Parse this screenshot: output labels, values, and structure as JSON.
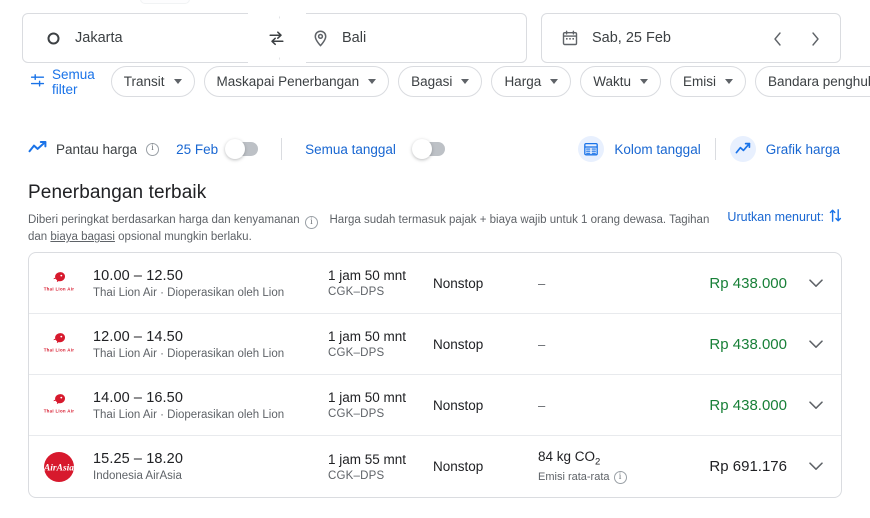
{
  "search": {
    "origin": "Jakarta",
    "destination": "Bali",
    "date": "Sab, 25 Feb",
    "swap_label": "swap-icon",
    "prev_label": "‹",
    "next_label": "›"
  },
  "filters": {
    "all_filters_label": "Semua filter",
    "chips": [
      {
        "label": "Transit"
      },
      {
        "label": "Maskapai Penerbangan"
      },
      {
        "label": "Bagasi"
      },
      {
        "label": "Harga"
      },
      {
        "label": "Waktu"
      },
      {
        "label": "Emisi"
      },
      {
        "label": "Bandara penghubung"
      }
    ]
  },
  "track": {
    "label": "Pantau harga",
    "date": "25 Feb",
    "all_dates": "Semua tanggal",
    "date_grid": "Kolom tanggal",
    "price_graph": "Grafik harga"
  },
  "section": {
    "title": "Penerbangan terbaik",
    "subtitle_a": "Diberi peringkat berdasarkan harga dan kenyamanan",
    "subtitle_b": "Harga sudah termasuk pajak + biaya wajib untuk 1 orang dewasa. Tagihan dan ",
    "subtitle_link": "biaya bagasi",
    "subtitle_c": " opsional mungkin berlaku.",
    "sort_label": "Urutkan menurut:"
  },
  "flights": [
    {
      "airline_logo": "thai-lion-air-logo",
      "times": "10.00 – 12.50",
      "airline": "Thai Lion Air · Dioperasikan oleh Lion",
      "duration": "1 jam 50 mnt",
      "route": "CGK–DPS",
      "stops": "Nonstop",
      "emissions": "–",
      "emissions_sub": "",
      "price": "Rp 438.000",
      "price_color": "green"
    },
    {
      "airline_logo": "thai-lion-air-logo",
      "times": "12.00 – 14.50",
      "airline": "Thai Lion Air · Dioperasikan oleh Lion",
      "duration": "1 jam 50 mnt",
      "route": "CGK–DPS",
      "stops": "Nonstop",
      "emissions": "–",
      "emissions_sub": "",
      "price": "Rp 438.000",
      "price_color": "green"
    },
    {
      "airline_logo": "thai-lion-air-logo",
      "times": "14.00 – 16.50",
      "airline": "Thai Lion Air · Dioperasikan oleh Lion",
      "duration": "1 jam 50 mnt",
      "route": "CGK–DPS",
      "stops": "Nonstop",
      "emissions": "–",
      "emissions_sub": "",
      "price": "Rp 438.000",
      "price_color": "green"
    },
    {
      "airline_logo": "airasia-logo",
      "times": "15.25 – 18.20",
      "airline": "Indonesia AirAsia",
      "duration": "1 jam 55 mnt",
      "route": "CGK–DPS",
      "stops": "Nonstop",
      "emissions": "84 kg CO2",
      "emissions_sub": "Emisi rata-rata",
      "price": "Rp 691.176",
      "price_color": "dark"
    }
  ],
  "colors": {
    "accent_blue": "#1a73e8",
    "price_green": "#188038",
    "airline_red": "#d7192d",
    "border": "#dadce0"
  }
}
